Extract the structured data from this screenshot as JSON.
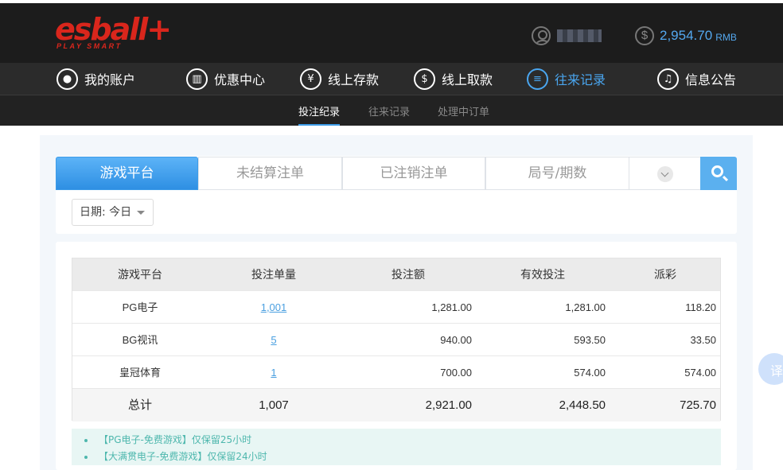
{
  "brand": {
    "name": "esball+",
    "tagline": "PLAY SMART"
  },
  "header": {
    "balance": "2,954.70",
    "currency": "RMB"
  },
  "nav": [
    {
      "label": "我的账户",
      "icon": "user-icon"
    },
    {
      "label": "优惠中心",
      "icon": "gift-icon"
    },
    {
      "label": "线上存款",
      "icon": "deposit-icon"
    },
    {
      "label": "线上取款",
      "icon": "withdraw-icon"
    },
    {
      "label": "往来记录",
      "icon": "records-icon",
      "active": true
    },
    {
      "label": "信息公告",
      "icon": "bell-icon"
    }
  ],
  "subnav": [
    {
      "label": "投注纪录",
      "active": true
    },
    {
      "label": "往来记录"
    },
    {
      "label": "处理中订单"
    }
  ],
  "tabs": [
    {
      "label": "游戏平台",
      "active": true
    },
    {
      "label": "未结算注单"
    },
    {
      "label": "已注销注单"
    },
    {
      "label": "局号/期数"
    }
  ],
  "filter": {
    "date_label": "日期: 今日"
  },
  "table": {
    "headers": [
      "游戏平台",
      "投注单量",
      "投注额",
      "有效投注",
      "派彩"
    ],
    "rows": [
      {
        "platform": "PG电子",
        "count": "1,001",
        "bet": "1,281.00",
        "valid": "1,281.00",
        "payout": "118.20"
      },
      {
        "platform": "BG视讯",
        "count": "5",
        "bet": "940.00",
        "valid": "593.50",
        "payout": "33.50"
      },
      {
        "platform": "皇冠体育",
        "count": "1",
        "bet": "700.00",
        "valid": "574.00",
        "payout": "574.00"
      }
    ],
    "total": {
      "label": "总计",
      "count": "1,007",
      "bet": "2,921.00",
      "valid": "2,448.50",
      "payout": "725.70"
    }
  },
  "notes": [
    "【PG电子-免费游戏】仅保留25小时",
    "【大满贯电子-免费游戏】仅保留24小时"
  ],
  "translate_label": "译",
  "colors": {
    "accent": "#3d9ce8",
    "logo": "#d9261c",
    "note": "#4db7ad"
  }
}
